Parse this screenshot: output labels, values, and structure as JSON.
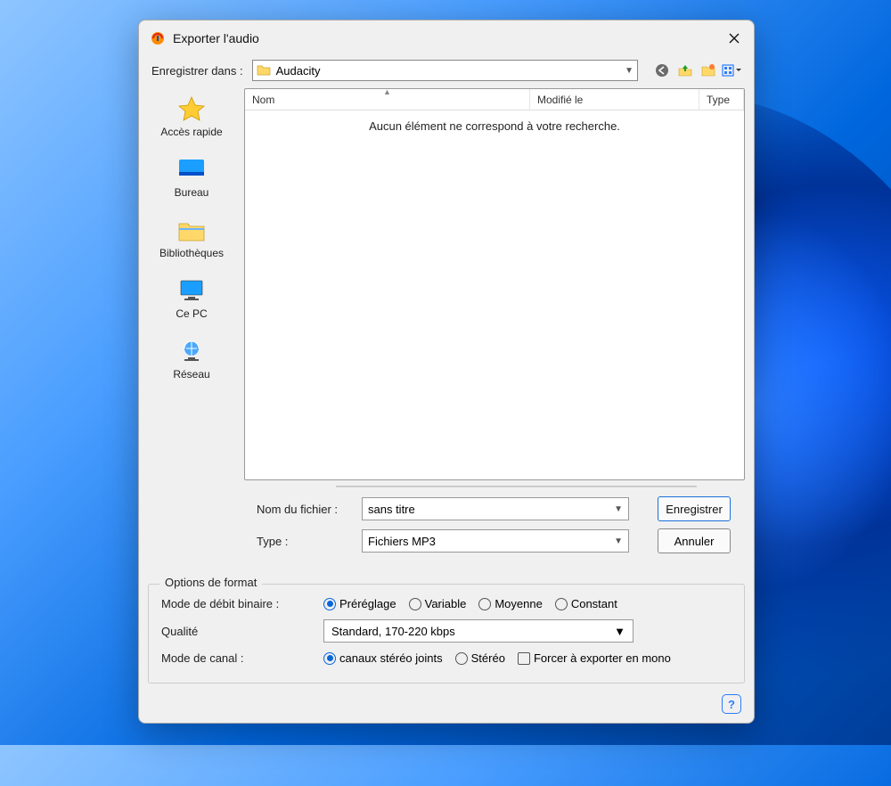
{
  "window": {
    "title": "Exporter l'audio"
  },
  "saveInLabel": "Enregistrer dans :",
  "location": "Audacity",
  "places": {
    "quick": "Accès rapide",
    "desktop": "Bureau",
    "libraries": "Bibliothèques",
    "thispc": "Ce PC",
    "network": "Réseau"
  },
  "columns": {
    "name": "Nom",
    "modified": "Modifié le",
    "type": "Type"
  },
  "emptyMessage": "Aucun élément ne correspond à votre recherche.",
  "filenameLabel": "Nom du fichier :",
  "filenameValue": "sans titre",
  "typeLabel": "Type :",
  "typeValue": "Fichiers MP3",
  "saveButton": "Enregistrer",
  "cancelButton": "Annuler",
  "formatLegend": "Options de format",
  "bitrateModeLabel": "Mode de débit binaire :",
  "bitrateOptions": {
    "preset": "Préréglage",
    "variable": "Variable",
    "average": "Moyenne",
    "constant": "Constant"
  },
  "qualityLabel": "Qualité",
  "qualityValue": "Standard, 170-220 kbps",
  "channelModeLabel": "Mode de canal :",
  "channelOptions": {
    "joint": "canaux stéréo joints",
    "stereo": "Stéréo",
    "forceMono": "Forcer à exporter en mono"
  },
  "helpTooltip": "?"
}
